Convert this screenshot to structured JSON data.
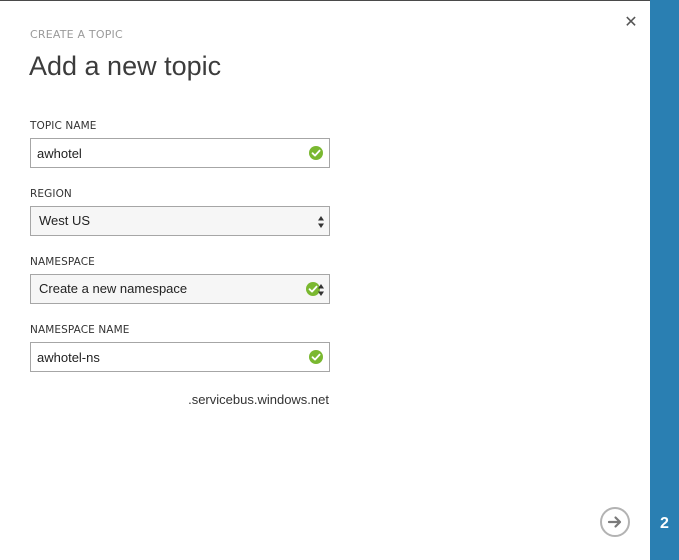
{
  "dialog": {
    "eyebrow": "CREATE A TOPIC",
    "title": "Add a new topic",
    "close_icon": "close-icon",
    "next_icon": "arrow-right-icon",
    "step": "2"
  },
  "form": {
    "topic_name": {
      "label": "TOPIC NAME",
      "value": "awhotel"
    },
    "region": {
      "label": "REGION",
      "value": "West US"
    },
    "namespace": {
      "label": "NAMESPACE",
      "value": "Create a new namespace"
    },
    "namespace_name": {
      "label": "NAMESPACE NAME",
      "value": "awhotel-ns"
    },
    "suffix": ".servicebus.windows.net"
  },
  "colors": {
    "accent": "#2a7fb2",
    "valid": "#7ab830"
  }
}
